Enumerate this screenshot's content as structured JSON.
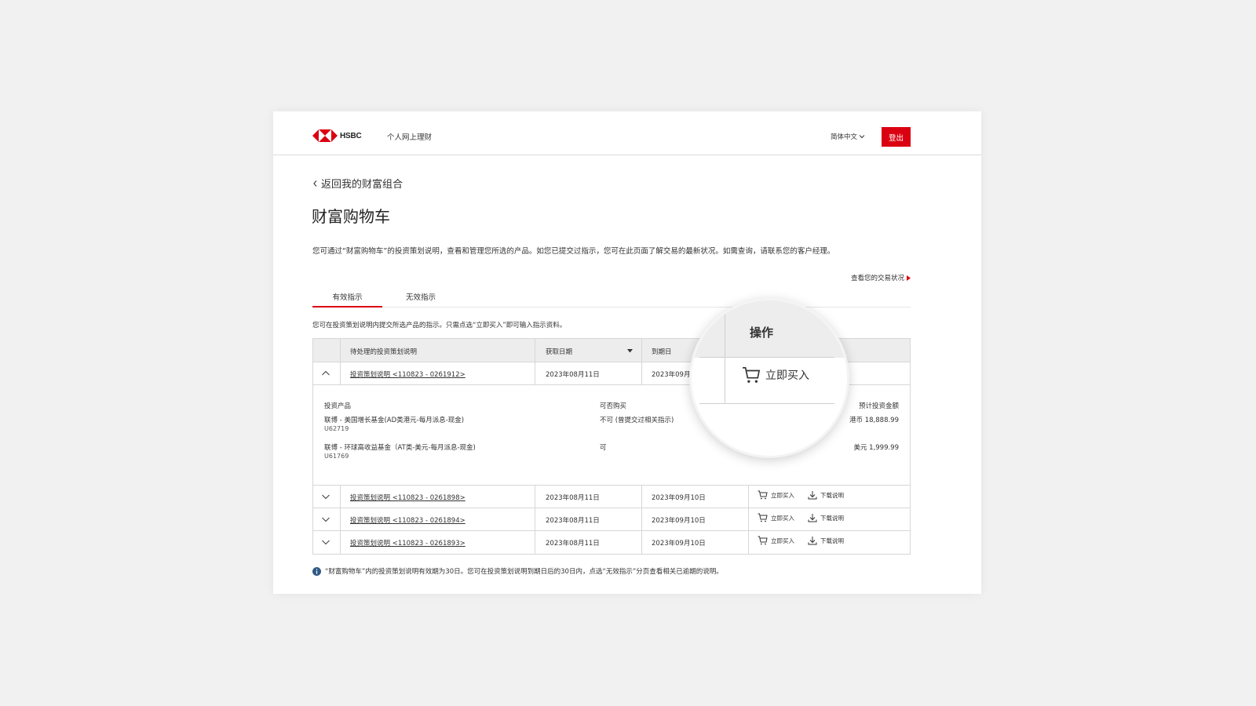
{
  "header": {
    "brand": "HSBC",
    "nav_label": "个人网上理财",
    "language": "简体中文",
    "logout_label": "登出"
  },
  "back_label": "返回我的财富组合",
  "page_title": "财富购物车",
  "intro": "您可通过“财富购物车”的投资策划说明，查看和管理您所选的产品。如您已提交过指示，您可在此页面了解交易的最新状况。如需查询，请联系您的客户经理。",
  "transaction_link": "查看您的交易状况",
  "tabs": [
    {
      "label": "有效指示",
      "active": true
    },
    {
      "label": "无效指示",
      "active": false
    }
  ],
  "tab_note": "您可在投资策划说明内提交所选产品的指示。只需点选“立即买入”即可输入指示资料。",
  "table": {
    "columns": [
      "待处理的投资策划说明",
      "获取日期",
      "到期日",
      "操作"
    ],
    "rows": [
      {
        "plan": "投资策划说明 <110823 - 0261912>",
        "acquired": "2023年08月11日",
        "expiry": "2023年09月",
        "expanded": true
      },
      {
        "plan": "投资策划说明 <110823 - 0261898>",
        "acquired": "2023年08月11日",
        "expiry": "2023年09月10日",
        "expanded": false
      },
      {
        "plan": "投资策划说明 <110823 - 0261894>",
        "acquired": "2023年08月11日",
        "expiry": "2023年09月10日",
        "expanded": false
      },
      {
        "plan": "投资策划说明 <110823 - 0261893>",
        "acquired": "2023年08月11日",
        "expiry": "2023年09月10日",
        "expanded": false
      }
    ],
    "detail": {
      "headers": {
        "product": "投资产品",
        "eligibility": "可否购买",
        "amount": "预计投资金额"
      },
      "items": [
        {
          "name": "联博 - 美国增长基金(AD类港元-每月派息-现金)",
          "code": "U62719",
          "eligibility": "不可 (曾提交过相关指示)",
          "amount": "港币 18,888.99"
        },
        {
          "name": "联博 - 环球高收益基金（AT类-美元-每月派息-现金)",
          "code": "U61769",
          "eligibility": "可",
          "amount": "美元 1,999.99"
        }
      ]
    },
    "buy_label": "立即买入",
    "download_label": "下载说明"
  },
  "footnote": "“财富购物车”内的投资策划说明有效期为30日。您可在投资策划说明到期日后的30日内，点选“无效指示”分页查看相关已逾期的说明。",
  "magnifier": {
    "header": "操作",
    "action": "立即买入"
  },
  "colors": {
    "brand_red": "#db0011",
    "header_gray": "#ededed",
    "info_blue": "#305a85"
  },
  "icons": [
    "hsbc-logo-icon",
    "chevron-left-icon",
    "chevron-down-icon",
    "chevron-up-icon",
    "sort-caret-icon",
    "cart-icon",
    "download-icon",
    "info-icon",
    "arrow-right-icon"
  ]
}
